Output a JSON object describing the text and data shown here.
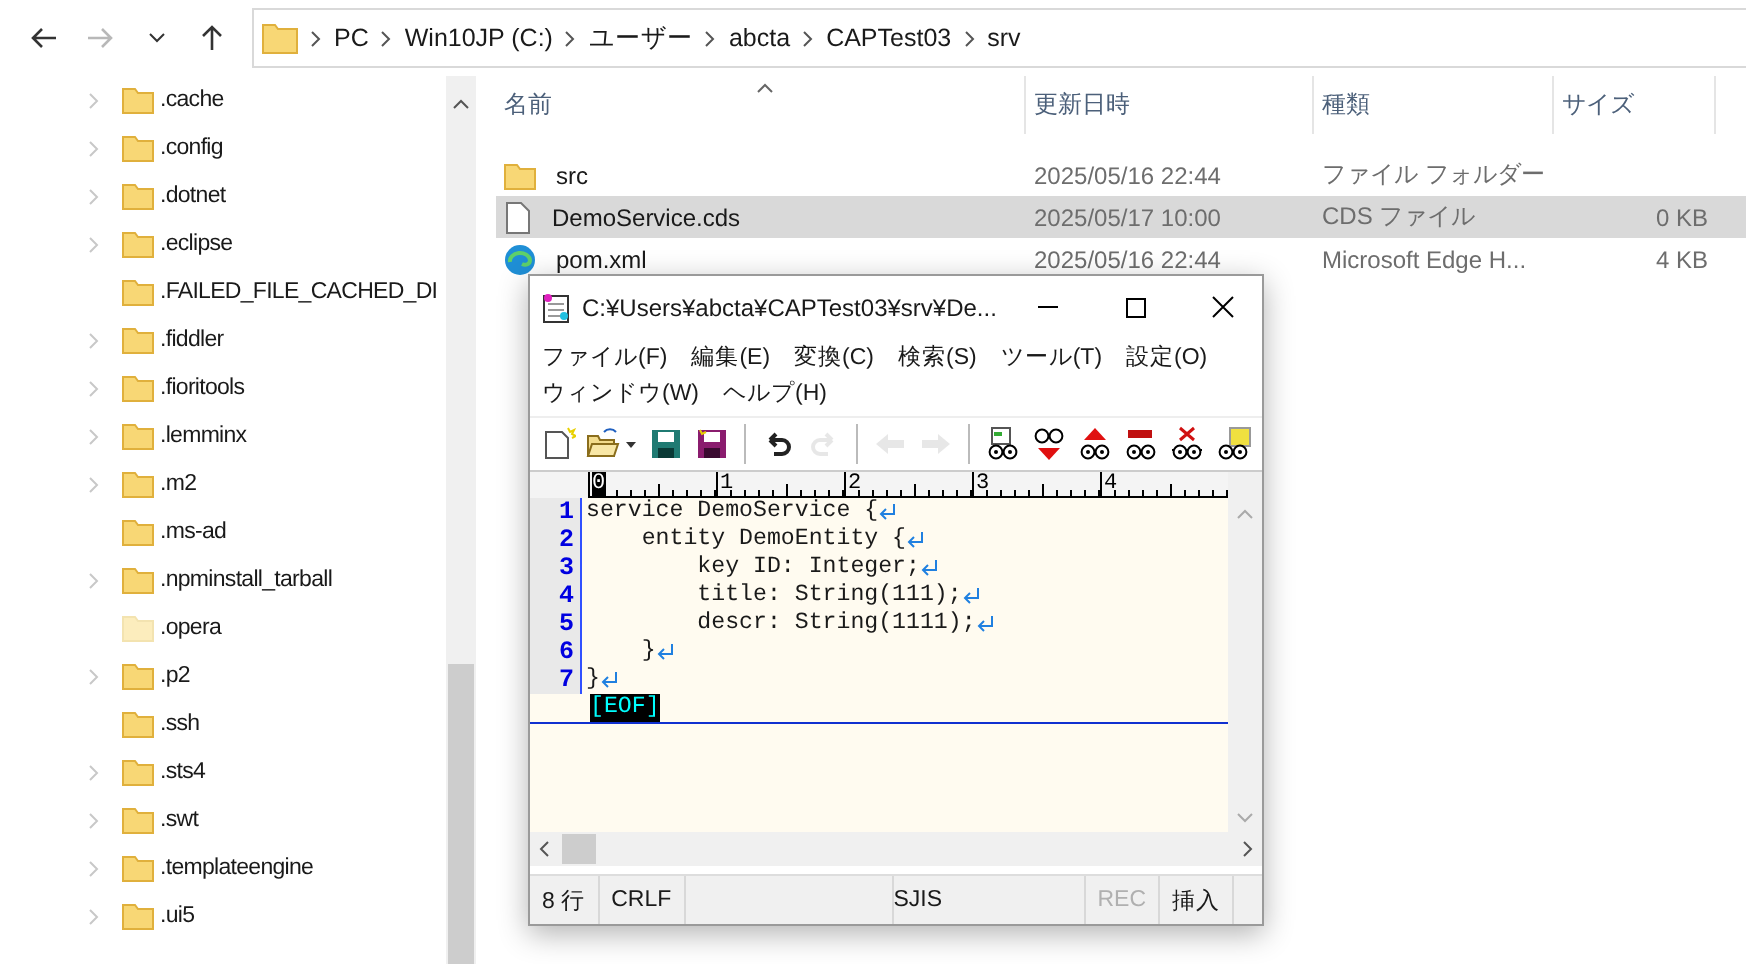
{
  "address_bar": {
    "crumbs": [
      "PC",
      "Win10JP (C:)",
      "ユーザー",
      "abcta",
      "CAPTest03",
      "srv"
    ],
    "forward_disabled": true
  },
  "nav_pane": {
    "items": [
      {
        "label": ".cache",
        "expandable": true,
        "hidden": false
      },
      {
        "label": ".config",
        "expandable": true,
        "hidden": false
      },
      {
        "label": ".dotnet",
        "expandable": true,
        "hidden": false
      },
      {
        "label": ".eclipse",
        "expandable": true,
        "hidden": false
      },
      {
        "label": ".FAILED_FILE_CACHED_DI",
        "expandable": false,
        "hidden": false
      },
      {
        "label": ".fiddler",
        "expandable": true,
        "hidden": false
      },
      {
        "label": ".fioritools",
        "expandable": true,
        "hidden": false
      },
      {
        "label": ".lemminx",
        "expandable": true,
        "hidden": false
      },
      {
        "label": ".m2",
        "expandable": true,
        "hidden": false
      },
      {
        "label": ".ms-ad",
        "expandable": false,
        "hidden": false
      },
      {
        "label": ".npminstall_tarball",
        "expandable": true,
        "hidden": false
      },
      {
        "label": ".opera",
        "expandable": false,
        "hidden": true
      },
      {
        "label": ".p2",
        "expandable": true,
        "hidden": false
      },
      {
        "label": ".ssh",
        "expandable": false,
        "hidden": false
      },
      {
        "label": ".sts4",
        "expandable": true,
        "hidden": false
      },
      {
        "label": ".swt",
        "expandable": true,
        "hidden": false
      },
      {
        "label": ".templateengine",
        "expandable": true,
        "hidden": false
      },
      {
        "label": ".ui5",
        "expandable": true,
        "hidden": false
      }
    ]
  },
  "file_list": {
    "columns": [
      {
        "label": "名前",
        "sorted": true
      },
      {
        "label": "更新日時",
        "sorted": false
      },
      {
        "label": "種類",
        "sorted": false
      },
      {
        "label": "サイズ",
        "sorted": false
      }
    ],
    "rows": [
      {
        "kind": "folder",
        "name": "src",
        "modified": "2025/05/16 22:44",
        "type": "ファイル フォルダー",
        "selected": false
      },
      {
        "kind": "file",
        "name": "DemoService.cds",
        "modified": "2025/05/17 10:00",
        "type": "CDS ファイル",
        "size": "0 KB",
        "selected": true
      },
      {
        "kind": "browser",
        "name": "pom.xml",
        "modified": "2025/05/16 22:44",
        "type": "Microsoft Edge H...",
        "size": "4 KB",
        "selected": false
      }
    ]
  },
  "editor": {
    "title": "C:¥Users¥abcta¥CAPTest03¥srv¥De...",
    "menus": [
      [
        "ファイル(F)",
        "編集(E)",
        "変換(C)",
        "検索(S)",
        "ツール(T)",
        "設定(O)"
      ],
      [
        "ウィンドウ(W)",
        "ヘルプ(H)"
      ]
    ],
    "toolbar": [
      [
        {
          "kind": "new",
          "disabled": false
        },
        {
          "kind": "open",
          "disabled": false
        },
        {
          "kind": "save",
          "disabled": false
        },
        {
          "kind": "saveall",
          "disabled": false
        }
      ],
      [
        {
          "kind": "undo",
          "disabled": false
        },
        {
          "kind": "redo",
          "disabled": true
        }
      ],
      [
        {
          "kind": "back",
          "disabled": true
        },
        {
          "kind": "forward",
          "disabled": true
        }
      ],
      [
        {
          "kind": "find",
          "disabled": false
        },
        {
          "kind": "down",
          "disabled": false
        },
        {
          "kind": "up",
          "disabled": false
        },
        {
          "kind": "replace",
          "disabled": false
        },
        {
          "kind": "clear",
          "disabled": false
        },
        {
          "kind": "grep",
          "disabled": false
        }
      ]
    ],
    "ruler": [
      "0",
      "1",
      "2",
      "3",
      "4"
    ],
    "lines": [
      {
        "number": "1",
        "text": "service DemoService {"
      },
      {
        "number": "2",
        "text": "    entity DemoEntity {"
      },
      {
        "number": "3",
        "text": "        key ID: Integer;"
      },
      {
        "number": "4",
        "text": "        title: String(111);"
      },
      {
        "number": "5",
        "text": "        descr: String(1111);"
      },
      {
        "number": "6",
        "text": "    }"
      },
      {
        "number": "7",
        "text": "}"
      }
    ],
    "eof": "[EOF]",
    "status": [
      {
        "kind": "narrow",
        "text": "8 行",
        "disabled": false
      },
      {
        "kind": "narrow",
        "text": "CRLF",
        "disabled": false
      },
      {
        "kind": "wide"
      },
      {
        "kind": "mid",
        "text": "SJIS",
        "disabled": false
      },
      {
        "kind": "narrow",
        "text": "REC",
        "disabled": true
      },
      {
        "kind": "narrow",
        "text": "挿入",
        "disabled": false
      }
    ]
  }
}
